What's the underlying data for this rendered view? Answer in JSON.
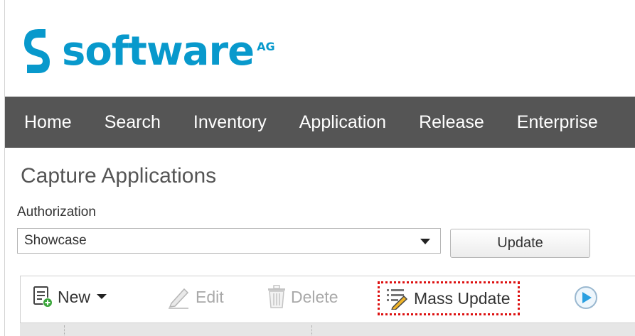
{
  "brand": {
    "name": "software",
    "suffix": "AG",
    "color": "#0899cc"
  },
  "nav": {
    "items": [
      {
        "label": "Home"
      },
      {
        "label": "Search"
      },
      {
        "label": "Inventory"
      },
      {
        "label": "Application"
      },
      {
        "label": "Release"
      },
      {
        "label": "Enterprise"
      }
    ],
    "background": "#555555"
  },
  "page": {
    "title": "Capture Applications"
  },
  "authorization": {
    "label": "Authorization",
    "selected": "Showcase",
    "update_label": "Update"
  },
  "toolbar": {
    "new_label": "New",
    "new_icon": "document-add-icon",
    "edit_label": "Edit",
    "edit_icon": "pencil-icon",
    "delete_label": "Delete",
    "delete_icon": "trash-icon",
    "mass_update_label": "Mass Update",
    "mass_update_icon": "list-edit-icon",
    "go_icon": "arrow-right-circle-icon",
    "highlight_color": "#dd1111"
  }
}
